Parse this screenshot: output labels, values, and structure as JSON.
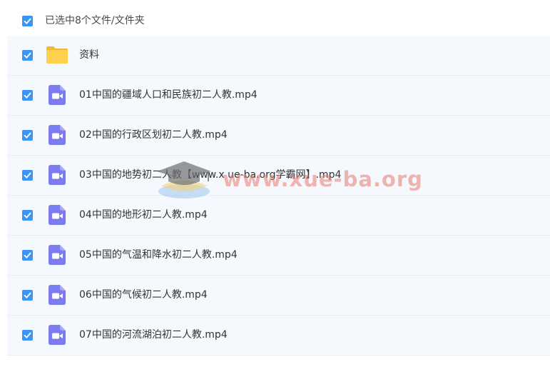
{
  "header": {
    "selection_label": "已选中8个文件/文件夹"
  },
  "watermark": {
    "text": "www.xue-ba.org"
  },
  "colors": {
    "checkbox": "#3a95f8",
    "folder": "#ffd04d",
    "video_icon": "#7c7cf0",
    "row_bg": "#f5f9fe"
  },
  "files": [
    {
      "name": "资料",
      "type": "folder",
      "icon": "folder-icon",
      "checked": true
    },
    {
      "name": "01中国的疆域人口和民族初二人教.mp4",
      "type": "video",
      "icon": "video-file-icon",
      "checked": true
    },
    {
      "name": "02中国的行政区划初二人教.mp4",
      "type": "video",
      "icon": "video-file-icon",
      "checked": true
    },
    {
      "name": "03中国的地势初二人教【www.x ue-ba.org学霸网】.mp4",
      "type": "video",
      "icon": "video-file-icon",
      "checked": true
    },
    {
      "name": "04中国的地形初二人教.mp4",
      "type": "video",
      "icon": "video-file-icon",
      "checked": true
    },
    {
      "name": "05中国的气温和降水初二人教.mp4",
      "type": "video",
      "icon": "video-file-icon",
      "checked": true
    },
    {
      "name": "06中国的气候初二人教.mp4",
      "type": "video",
      "icon": "video-file-icon",
      "checked": true
    },
    {
      "name": "07中国的河流湖泊初二人教.mp4",
      "type": "video",
      "icon": "video-file-icon",
      "checked": true
    }
  ]
}
